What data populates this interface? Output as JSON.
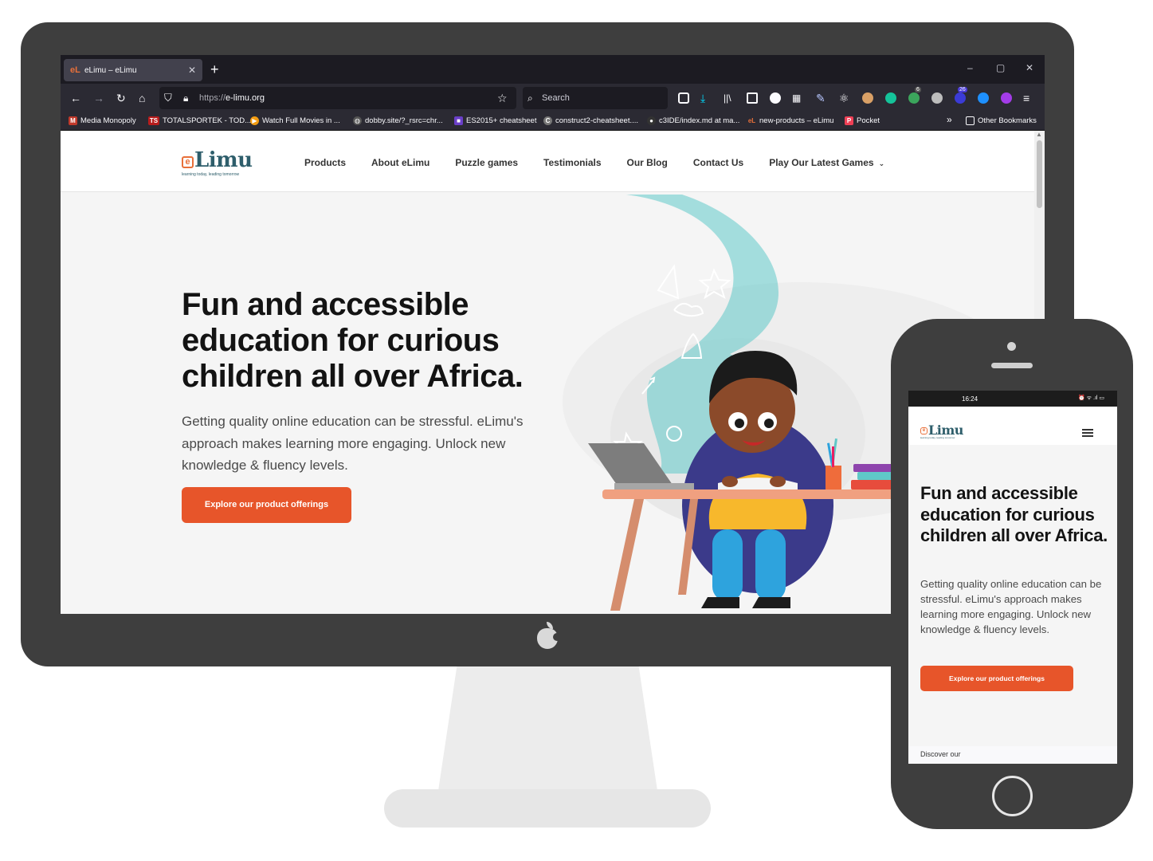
{
  "browser": {
    "tab_title": "eLimu – eLimu",
    "tab_favicon": "eL",
    "new_tab_label": "+",
    "window_controls": [
      "–",
      "▢",
      "✕"
    ],
    "url_protocol": "https://",
    "url_host": "e-limu.org",
    "search_placeholder": "Search",
    "badges": {
      "extension_a": "6",
      "extension_b": "26"
    },
    "bookmarks": [
      {
        "label": "Media Monopoly",
        "icon": "M",
        "color": "#c0392b"
      },
      {
        "label": "TOTALSPORTEK - TOD...",
        "icon": "TS",
        "color": "#b71c1c"
      },
      {
        "label": "Watch Full Movies in ...",
        "icon": "▶",
        "color": "#f39c12"
      },
      {
        "label": "dobby.site/?_rsrc=chr...",
        "icon": "◍",
        "color": "#555555"
      },
      {
        "label": "ES2015+ cheatsheet",
        "icon": "■",
        "color": "#6a3fc8"
      },
      {
        "label": "construct2-cheatsheet....",
        "icon": "C",
        "color": "#777777"
      },
      {
        "label": "c3IDE/index.md at ma...",
        "icon": "●",
        "color": "#333333"
      },
      {
        "label": "new-products – eLimu",
        "icon": "eL",
        "color": "#e8703a"
      },
      {
        "label": "Pocket",
        "icon": "P",
        "color": "#ef4056"
      }
    ],
    "other_bookmarks": "Other Bookmarks",
    "more_chevron": "»"
  },
  "site": {
    "logo_word": "Limu",
    "logo_letter": "e",
    "logo_tagline": "learning today, leading tomorrow",
    "nav": [
      "Products",
      "About eLimu",
      "Puzzle games",
      "Testimonials",
      "Our Blog",
      "Contact Us",
      "Play Our Latest Games"
    ],
    "nav_dropdown_icon": "⌄",
    "hero_title": "Fun and accessible education for curious children all over Africa.",
    "hero_text": "Getting quality online education can be stressful. eLimu's approach makes learning more engaging. Unlock new knowledge & fluency levels.",
    "cta_label": "Explore our product offerings",
    "brand_color": "#e7552a",
    "logo_color": "#2e5e6b"
  },
  "phone": {
    "time": "16:24",
    "status_icons": "⏰ ᯤ .ıl ▭",
    "hero_title": "Fun and accessible education for curious children all over Africa.",
    "hero_text": "Getting quality online education can be stressful. eLimu's approach makes learning more engaging. Unlock new knowledge & fluency levels.",
    "cta_label": "Explore our product offerings",
    "discover_text": "Discover our"
  }
}
